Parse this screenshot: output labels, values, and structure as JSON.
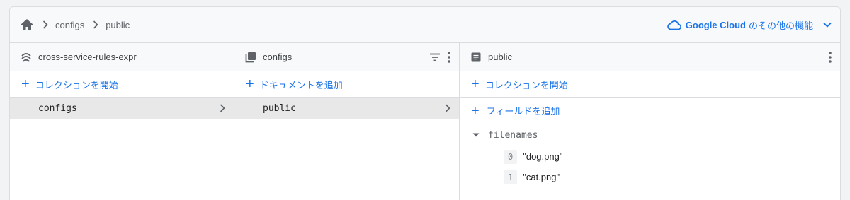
{
  "breadcrumb": {
    "home_icon": "home-icon",
    "items": [
      "configs",
      "public"
    ]
  },
  "google_cloud": {
    "brand": "Google Cloud",
    "suffix": "のその他の機能"
  },
  "columns": {
    "root": {
      "title": "cross-service-rules-expr",
      "icon": "database-icon",
      "add_label": "コレクションを開始",
      "items": [
        "configs"
      ]
    },
    "collection": {
      "title": "configs",
      "icon": "collection-icon",
      "add_label": "ドキュメントを追加",
      "items": [
        "public"
      ]
    },
    "document": {
      "title": "public",
      "icon": "document-icon",
      "add_collection_label": "コレクションを開始",
      "add_field_label": "フィールドを追加",
      "field_name": "filenames",
      "array": [
        {
          "index": "0",
          "value": "\"dog.png\""
        },
        {
          "index": "1",
          "value": "\"cat.png\""
        }
      ]
    }
  },
  "colors": {
    "accent": "#1a73e8",
    "selected_row": "#e8e8e8",
    "header_bg": "#f8f9fa"
  }
}
